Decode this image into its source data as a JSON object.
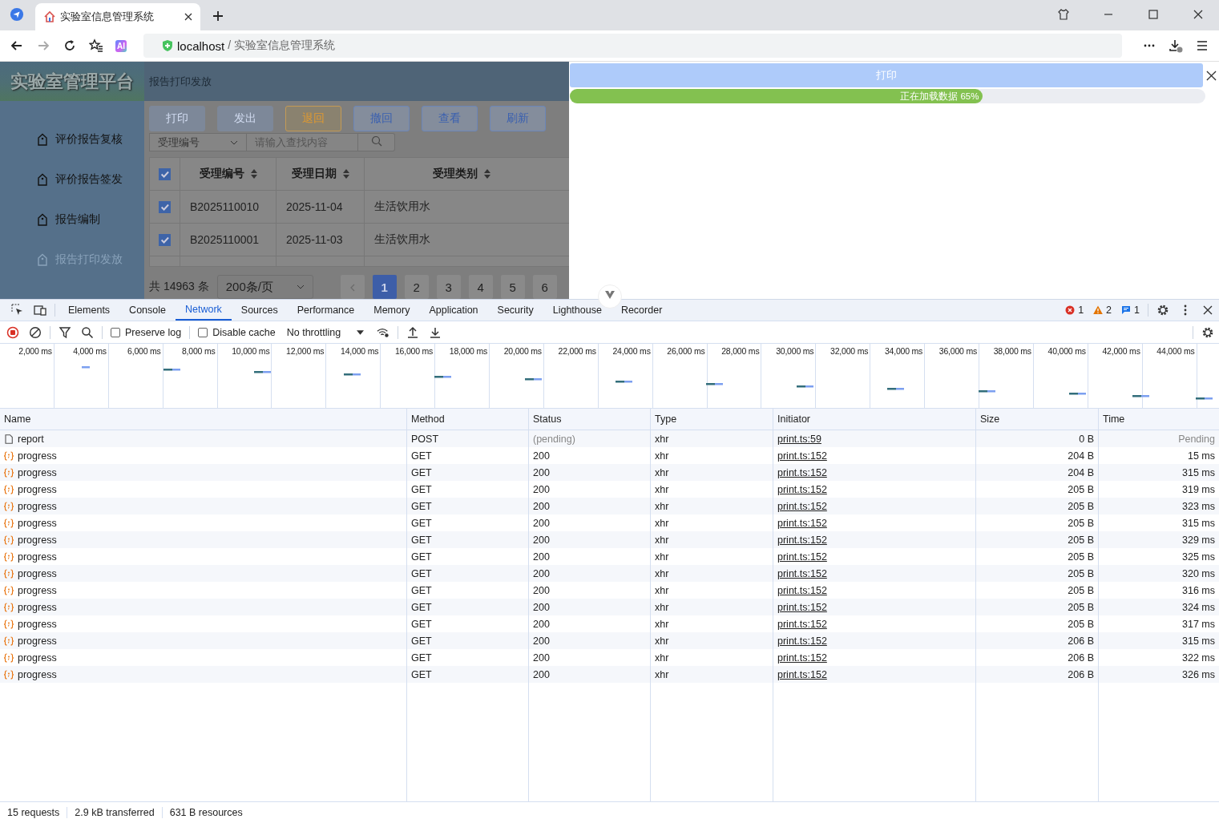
{
  "browser": {
    "tab_title": "实验室信息管理系统",
    "extension_label": "AI",
    "address_host": "localhost",
    "address_separator": "/",
    "address_path": "实验室信息管理系统"
  },
  "app": {
    "logo": "实验室管理平台",
    "breadcrumb": "报告打印发放",
    "sidebar": [
      {
        "label": "评价报告复核",
        "selected": false
      },
      {
        "label": "评价报告签发",
        "selected": false
      },
      {
        "label": "报告编制",
        "selected": false
      },
      {
        "label": "报告打印发放",
        "selected": true
      }
    ],
    "toolbar": [
      {
        "label": "打印",
        "kind": "disabled"
      },
      {
        "label": "发出",
        "kind": "disabled"
      },
      {
        "label": "退回",
        "kind": "warning"
      },
      {
        "label": "撤回",
        "kind": "plain"
      },
      {
        "label": "查看",
        "kind": "plain"
      },
      {
        "label": "刷新",
        "kind": "plain"
      }
    ],
    "search": {
      "field": "受理编号",
      "placeholder": "请输入查找内容"
    },
    "table": {
      "all_checked": true,
      "columns": [
        "受理编号",
        "受理日期",
        "受理类别"
      ],
      "rows": [
        {
          "checked": true,
          "cells": [
            "B2025110010",
            "2025-11-04",
            "生活饮用水"
          ]
        },
        {
          "checked": true,
          "cells": [
            "B2025110001",
            "2025-11-03",
            "生活饮用水"
          ]
        }
      ]
    },
    "pagination": {
      "total": "共 14963 条",
      "page_size": "200条/页",
      "pages": [
        {
          "label": "1",
          "selected": true
        },
        {
          "label": "2",
          "selected": false
        },
        {
          "label": "3",
          "selected": false
        },
        {
          "label": "4",
          "selected": false
        },
        {
          "label": "5",
          "selected": false
        },
        {
          "label": "6",
          "selected": false
        }
      ]
    }
  },
  "print_dialog": {
    "title": "打印",
    "progress": {
      "level": 0.65,
      "label": "正在加载数据 65%"
    }
  },
  "devtools": {
    "tabs": [
      {
        "label": "Elements",
        "selected": false
      },
      {
        "label": "Console",
        "selected": false
      },
      {
        "label": "Network",
        "selected": true
      },
      {
        "label": "Sources",
        "selected": false
      },
      {
        "label": "Performance",
        "selected": false
      },
      {
        "label": "Memory",
        "selected": false
      },
      {
        "label": "Application",
        "selected": false
      },
      {
        "label": "Security",
        "selected": false
      },
      {
        "label": "Lighthouse",
        "selected": false
      },
      {
        "label": "Recorder",
        "selected": false
      }
    ],
    "errors": "1",
    "warnings": "2",
    "messages": "1",
    "preserve_log": {
      "label": "Preserve log",
      "checked": false
    },
    "disable_cache": {
      "label": "Disable cache",
      "checked": false
    },
    "throttling": "No throttling",
    "ticks": [
      "2,000 ms",
      "4,000 ms",
      "6,000 ms",
      "8,000 ms",
      "10,000 ms",
      "12,000 ms",
      "14,000 ms",
      "16,000 ms",
      "18,000 ms",
      "20,000 ms",
      "22,000 ms",
      "24,000 ms",
      "26,000 ms",
      "28,000 ms",
      "30,000 ms",
      "32,000 ms",
      "34,000 ms",
      "36,000 ms",
      "38,000 ms",
      "40,000 ms",
      "42,000 ms",
      "44,000 ms"
    ],
    "columns": [
      "Name",
      "Method",
      "Status",
      "Type",
      "Initiator",
      "Size",
      "Time"
    ],
    "rows": [
      {
        "name": "report",
        "kind": "document",
        "method": "POST",
        "status": "(pending)",
        "pending": true,
        "type": "xhr",
        "initiator": "print.ts:59",
        "size": "0 B",
        "time": "Pending"
      },
      {
        "name": "progress",
        "kind": "fetch",
        "method": "GET",
        "status": "200",
        "pending": false,
        "type": "xhr",
        "initiator": "print.ts:152",
        "size": "204 B",
        "time": "15 ms"
      },
      {
        "name": "progress",
        "kind": "fetch",
        "method": "GET",
        "status": "200",
        "pending": false,
        "type": "xhr",
        "initiator": "print.ts:152",
        "size": "204 B",
        "time": "315 ms"
      },
      {
        "name": "progress",
        "kind": "fetch",
        "method": "GET",
        "status": "200",
        "pending": false,
        "type": "xhr",
        "initiator": "print.ts:152",
        "size": "205 B",
        "time": "319 ms"
      },
      {
        "name": "progress",
        "kind": "fetch",
        "method": "GET",
        "status": "200",
        "pending": false,
        "type": "xhr",
        "initiator": "print.ts:152",
        "size": "205 B",
        "time": "323 ms"
      },
      {
        "name": "progress",
        "kind": "fetch",
        "method": "GET",
        "status": "200",
        "pending": false,
        "type": "xhr",
        "initiator": "print.ts:152",
        "size": "205 B",
        "time": "315 ms"
      },
      {
        "name": "progress",
        "kind": "fetch",
        "method": "GET",
        "status": "200",
        "pending": false,
        "type": "xhr",
        "initiator": "print.ts:152",
        "size": "205 B",
        "time": "329 ms"
      },
      {
        "name": "progress",
        "kind": "fetch",
        "method": "GET",
        "status": "200",
        "pending": false,
        "type": "xhr",
        "initiator": "print.ts:152",
        "size": "205 B",
        "time": "325 ms"
      },
      {
        "name": "progress",
        "kind": "fetch",
        "method": "GET",
        "status": "200",
        "pending": false,
        "type": "xhr",
        "initiator": "print.ts:152",
        "size": "205 B",
        "time": "320 ms"
      },
      {
        "name": "progress",
        "kind": "fetch",
        "method": "GET",
        "status": "200",
        "pending": false,
        "type": "xhr",
        "initiator": "print.ts:152",
        "size": "205 B",
        "time": "316 ms"
      },
      {
        "name": "progress",
        "kind": "fetch",
        "method": "GET",
        "status": "200",
        "pending": false,
        "type": "xhr",
        "initiator": "print.ts:152",
        "size": "205 B",
        "time": "324 ms"
      },
      {
        "name": "progress",
        "kind": "fetch",
        "method": "GET",
        "status": "200",
        "pending": false,
        "type": "xhr",
        "initiator": "print.ts:152",
        "size": "205 B",
        "time": "317 ms"
      },
      {
        "name": "progress",
        "kind": "fetch",
        "method": "GET",
        "status": "200",
        "pending": false,
        "type": "xhr",
        "initiator": "print.ts:152",
        "size": "206 B",
        "time": "315 ms"
      },
      {
        "name": "progress",
        "kind": "fetch",
        "method": "GET",
        "status": "200",
        "pending": false,
        "type": "xhr",
        "initiator": "print.ts:152",
        "size": "206 B",
        "time": "322 ms"
      },
      {
        "name": "progress",
        "kind": "fetch",
        "method": "GET",
        "status": "200",
        "pending": false,
        "type": "xhr",
        "initiator": "print.ts:152",
        "size": "206 B",
        "time": "326 ms"
      }
    ],
    "status_bar": [
      "15 requests",
      "2.9 kB transferred",
      "631 B resources"
    ]
  }
}
